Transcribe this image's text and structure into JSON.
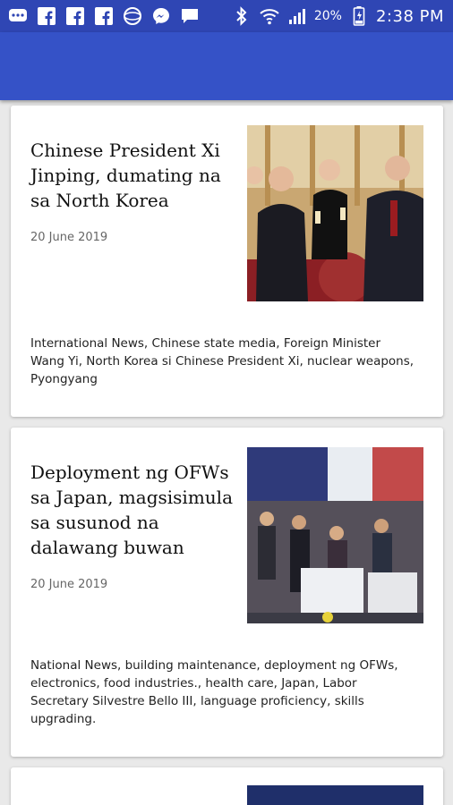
{
  "status_bar": {
    "icons": [
      "chat-bubble-icon",
      "facebook-icon",
      "facebook-icon",
      "facebook-icon",
      "world-icon",
      "messenger-icon",
      "message-icon",
      "bluetooth-icon",
      "wifi-icon",
      "signal-icon",
      "battery-icon"
    ],
    "battery": "20%",
    "time": "2:38 PM"
  },
  "colors": {
    "status_bar": "#2f46b4",
    "app_bar": "#3552c7",
    "background": "#e9e9e9",
    "card": "#ffffff"
  },
  "articles": [
    {
      "title": "Chinese President Xi Jinping, dumating na sa North Korea",
      "date": "20 June 2019",
      "tags": "International News, Chinese state media, Foreign Minister Wang Yi, North Korea si Chinese President Xi, nuclear weapons, Pyongyang"
    },
    {
      "title": "Deployment ng OFWs sa Japan, magsisimula sa susunod na dalawang buwan",
      "date": "20 June 2019",
      "tags": "National News, building maintenance, deployment ng OFWs, electronics, food industries., health care, Japan, Labor Secretary Silvestre Bello III, language proficiency, skills upgrading."
    }
  ]
}
